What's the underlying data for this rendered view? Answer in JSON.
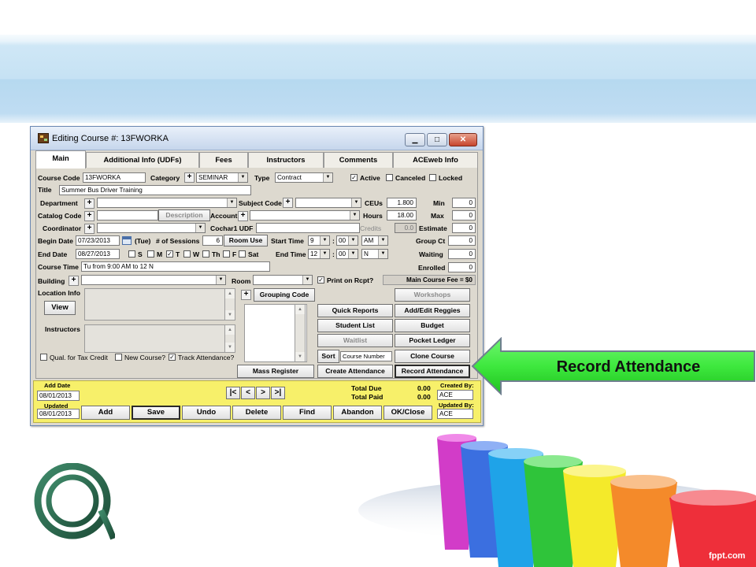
{
  "slide": {
    "label": "Record Attendance",
    "watermark": "fppt.com",
    "colors": {
      "arrow": "#3ee83e",
      "banner": "#c6e2f4"
    }
  },
  "window": {
    "title": "Editing Course #: 13FWORKA",
    "controls": {
      "minimize": "▁",
      "maximize": "□",
      "close": "✕"
    }
  },
  "tabs": [
    "Main",
    "Additional Info (UDFs)",
    "Fees",
    "Instructors",
    "Comments",
    "ACEweb Info"
  ],
  "form": {
    "course_code_label": "Course Code",
    "course_code": "13FWORKA",
    "category_label": "Category",
    "category": "SEMINAR",
    "type_label": "Type",
    "type": "Contract",
    "active": "Active",
    "canceled": "Canceled",
    "locked": "Locked",
    "title_label": "Title",
    "title": "Summer Bus Driver Training",
    "department_label": "Department",
    "subject_code_label": "Subject Code",
    "ceus_label": "CEUs",
    "ceus": "1.800",
    "min_label": "Min",
    "min": "0",
    "catalog_code_label": "Catalog Code",
    "description_btn": "Description",
    "account_label": "Account",
    "hours_label": "Hours",
    "hours": "18.00",
    "max_label": "Max",
    "max": "0",
    "coordinator_label": "Coordinator",
    "cochar_label": "Cochar1 UDF",
    "credits_label": "Credits",
    "credits": "0.0",
    "estimate_label": "Estimate",
    "estimate": "0",
    "begin_date_label": "Begin Date",
    "begin_date": "07/23/2013",
    "begin_day": "(Tue)",
    "sessions_label": "# of Sessions",
    "sessions": "6",
    "room_use_btn": "Room Use",
    "start_time_label": "Start Time",
    "start_hour": "9",
    "start_min": "00",
    "start_ampm": "AM",
    "group_ct_label": "Group Ct",
    "group_ct": "0",
    "end_date_label": "End Date",
    "end_date": "08/27/2013",
    "days": [
      "S",
      "M",
      "T",
      "W",
      "Th",
      "F",
      "Sat"
    ],
    "end_time_label": "End Time",
    "end_hour": "12",
    "end_min": "00",
    "end_ampm": "N",
    "waiting_label": "Waiting",
    "waiting": "0",
    "course_time_label": "Course Time",
    "course_time": "Tu from 9:00 AM to 12 N",
    "enrolled_label": "Enrolled",
    "enrolled": "0",
    "building_label": "Building",
    "room_label": "Room",
    "print_on_rcpt": "Print on Rcpt?",
    "main_course_fee": "Main Course Fee = $0",
    "location_info_label": "Location Info",
    "view_btn": "View",
    "grouping_code_btn": "Grouping Code",
    "instructors_label": "Instructors",
    "qual_tax": "Qual. for Tax Credit",
    "new_course": "New Course?",
    "track_attendance": "Track Attendance?",
    "sort_label": "Sort",
    "sort_value": "Course Number"
  },
  "buttons": {
    "workshops": "Workshops",
    "quick_reports": "Quick Reports",
    "add_edit_reggies": "Add/Edit Reggies",
    "student_list": "Student List",
    "budget": "Budget",
    "waitlist": "Waitlist",
    "pocket_ledger": "Pocket Ledger",
    "clone_course": "Clone Course",
    "mass_register": "Mass Register",
    "create_attendance": "Create Attendance",
    "record_attendance": "Record Attendance"
  },
  "footer": {
    "add_date_label": "Add Date",
    "add_date": "08/01/2013",
    "updated_label": "Updated",
    "updated": "08/01/2013",
    "nav": [
      "|<",
      "<",
      ">",
      ">|"
    ],
    "total_due_label": "Total Due",
    "total_due": "0.00",
    "total_paid_label": "Total Paid",
    "total_paid": "0.00",
    "created_by_label": "Created By:",
    "created_by": "ACE",
    "updated_by_label": "Updated By:",
    "updated_by": "ACE",
    "actions": [
      "Add",
      "Save",
      "Undo",
      "Delete",
      "Find",
      "Abandon",
      "OK/Close"
    ]
  }
}
